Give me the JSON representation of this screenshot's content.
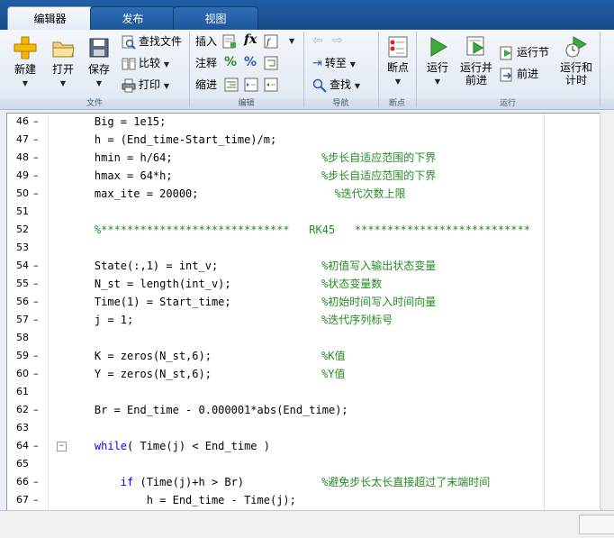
{
  "tabs": [
    {
      "label": "编辑器",
      "active": true
    },
    {
      "label": "发布",
      "active": false
    },
    {
      "label": "视图",
      "active": false
    }
  ],
  "ribbon": {
    "groups": {
      "file": "文件",
      "edit": "编辑",
      "navigate": "导航",
      "breakpoints": "断点",
      "run": "运行"
    },
    "file": {
      "new": "新建",
      "open": "打开",
      "save": "保存",
      "find_files": "查找文件",
      "compare": "比较",
      "print": "打印"
    },
    "edit": {
      "insert": "插入",
      "comment": "注释",
      "indent": "缩进"
    },
    "navigate": {
      "goto": "转至",
      "find": "查找"
    },
    "breakpoints": {
      "breakpoints": "断点"
    },
    "run": {
      "run": "运行",
      "run_advance": "运行并\n前进",
      "run_section": "运行节",
      "advance": "前进",
      "run_time": "运行和\n计时"
    }
  },
  "editor": {
    "lines": [
      {
        "n": "46",
        "dash": "–",
        "code": "    Big = 1e15;",
        "comment": ""
      },
      {
        "n": "47",
        "dash": "–",
        "code": "    h = (End_time-Start_time)/m;",
        "comment": ""
      },
      {
        "n": "48",
        "dash": "–",
        "code": "    hmin = h/64;",
        "comment": "%步长自适应范围的下界"
      },
      {
        "n": "49",
        "dash": "–",
        "code": "    hmax = 64*h;",
        "comment": "%步长自适应范围的下界"
      },
      {
        "n": "50",
        "dash": "–",
        "code": "    max_ite = 20000;",
        "comment": "  %迭代次数上限"
      },
      {
        "n": "51",
        "dash": "",
        "code": "",
        "comment": ""
      },
      {
        "n": "52",
        "dash": "",
        "code": "",
        "comment": "    %*****************************   RK45   ***************************"
      },
      {
        "n": "53",
        "dash": "",
        "code": "",
        "comment": ""
      },
      {
        "n": "54",
        "dash": "–",
        "code": "    State(:,1) = int_v;",
        "comment": "%初值写入输出状态变量"
      },
      {
        "n": "55",
        "dash": "–",
        "code": "    N_st = length(int_v);",
        "comment": "%状态变量数"
      },
      {
        "n": "56",
        "dash": "–",
        "code": "    Time(1) = Start_time;",
        "comment": "%初始时间写入时间向量"
      },
      {
        "n": "57",
        "dash": "–",
        "code": "    j = 1;",
        "comment": "%迭代序列标号"
      },
      {
        "n": "58",
        "dash": "",
        "code": "",
        "comment": ""
      },
      {
        "n": "59",
        "dash": "–",
        "code": "    K = zeros(N_st,6);",
        "comment": "%K值"
      },
      {
        "n": "60",
        "dash": "–",
        "code": "    Y = zeros(N_st,6);",
        "comment": "%Y值"
      },
      {
        "n": "61",
        "dash": "",
        "code": "",
        "comment": ""
      },
      {
        "n": "62",
        "dash": "–",
        "code": "    Br = End_time - 0.000001*abs(End_time);",
        "comment": ""
      },
      {
        "n": "63",
        "dash": "",
        "code": "",
        "comment": ""
      },
      {
        "n": "64",
        "dash": "–",
        "kw": "while",
        "code": "( Time(j) < End_time )",
        "comment": ""
      },
      {
        "n": "65",
        "dash": "",
        "code": "",
        "comment": ""
      },
      {
        "n": "66",
        "dash": "–",
        "kw": "if",
        "code": " (Time(j)+h > Br)",
        "comment": "%避免步长太长直接超过了末端时间"
      },
      {
        "n": "67",
        "dash": "–",
        "code": "            h = End_time - Time(j);",
        "comment": ""
      }
    ]
  },
  "colors": {
    "keyword": "#0000ff",
    "comment": "#228b22",
    "tab_bar": "#1f5fa6"
  }
}
